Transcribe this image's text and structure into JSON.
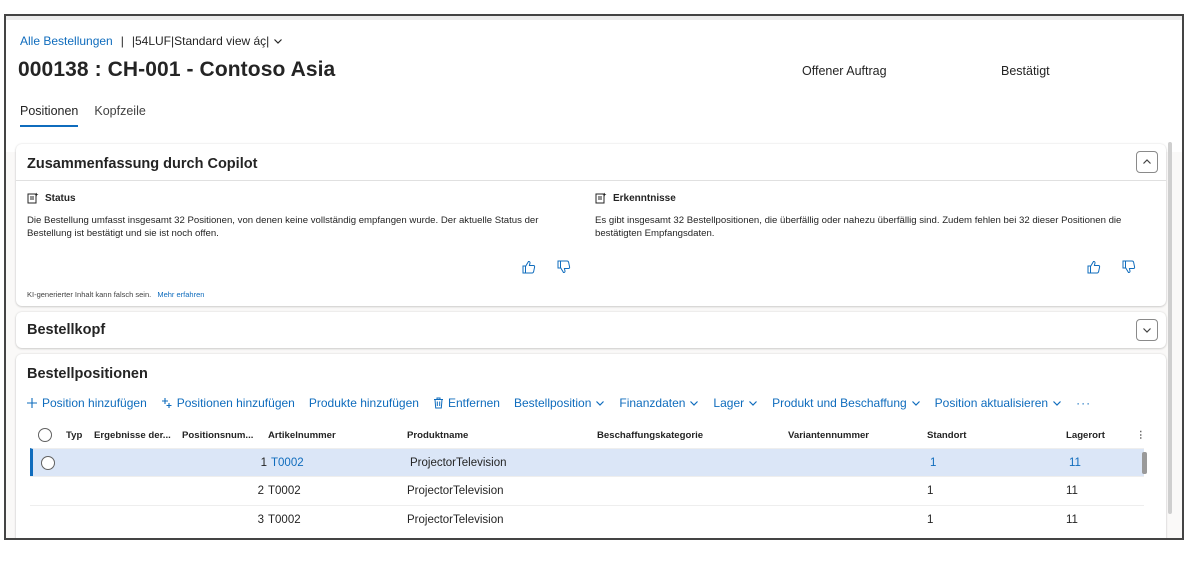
{
  "header": {
    "breadcrumb_link": "Alle Bestellungen",
    "breadcrumb_sep": "|",
    "view_name": "|54LUF|Standard view áç|",
    "title": "000138 : CH-001 - Contoso Asia",
    "status_1": "Offener Auftrag",
    "status_2": "Bestätigt",
    "tabs": [
      {
        "label": "Positionen",
        "active": true
      },
      {
        "label": "Kopfzeile",
        "active": false
      }
    ]
  },
  "copilot": {
    "title": "Zusammenfassung durch Copilot",
    "status": {
      "heading": "Status",
      "text": "Die Bestellung umfasst insgesamt 32 Positionen, von denen keine vollständig empfangen wurde. Der aktuelle Status der Bestellung ist bestätigt und sie ist noch offen."
    },
    "insights": {
      "heading": "Erkenntnisse",
      "text": "Es gibt insgesamt 32 Bestellpositionen, die überfällig oder nahezu überfällig sind. Zudem fehlen bei 32 dieser Positionen die bestätigten Empfangsdaten."
    },
    "disclaimer": "KI-generierter Inhalt kann falsch sein.",
    "learn_more": "Mehr erfahren"
  },
  "bestellkopf": {
    "title": "Bestellkopf"
  },
  "lines": {
    "title": "Bestellpositionen",
    "toolbar": {
      "add_line": "Position hinzufügen",
      "add_lines": "Positionen hinzufügen",
      "add_products": "Produkte hinzufügen",
      "remove": "Entfernen",
      "line_menu": "Bestellposition",
      "finance_menu": "Finanzdaten",
      "warehouse_menu": "Lager",
      "product_menu": "Produkt und Beschaffung",
      "update_menu": "Position aktualisieren",
      "more": "···"
    },
    "columns": {
      "type": "Typ",
      "results": "Ergebnisse der...",
      "line_number": "Positionsnum...",
      "item_number": "Artikelnummer",
      "product_name": "Produktname",
      "procurement_category": "Beschaffungskategorie",
      "variant_number": "Variantennummer",
      "site": "Standort",
      "warehouse": "Lagerort"
    },
    "rows": [
      {
        "line_number": "1",
        "item_number": "T0002",
        "product_name": "ProjectorTelevision",
        "site": "1",
        "warehouse": "11",
        "selected": true
      },
      {
        "line_number": "2",
        "item_number": "T0002",
        "product_name": "ProjectorTelevision",
        "site": "1",
        "warehouse": "11",
        "selected": false
      },
      {
        "line_number": "3",
        "item_number": "T0002",
        "product_name": "ProjectorTelevision",
        "site": "1",
        "warehouse": "11",
        "selected": false
      }
    ]
  },
  "colors": {
    "accent": "#0f6cbd",
    "selected_row": "#dbe6f7"
  },
  "icons": [
    "chevron-down-icon",
    "chevron-up-icon",
    "copilot-note-icon",
    "thumbs-up-icon",
    "thumbs-down-icon",
    "add-icon",
    "add-multiple-icon",
    "delete-icon",
    "more-icon",
    "radio-icon"
  ]
}
